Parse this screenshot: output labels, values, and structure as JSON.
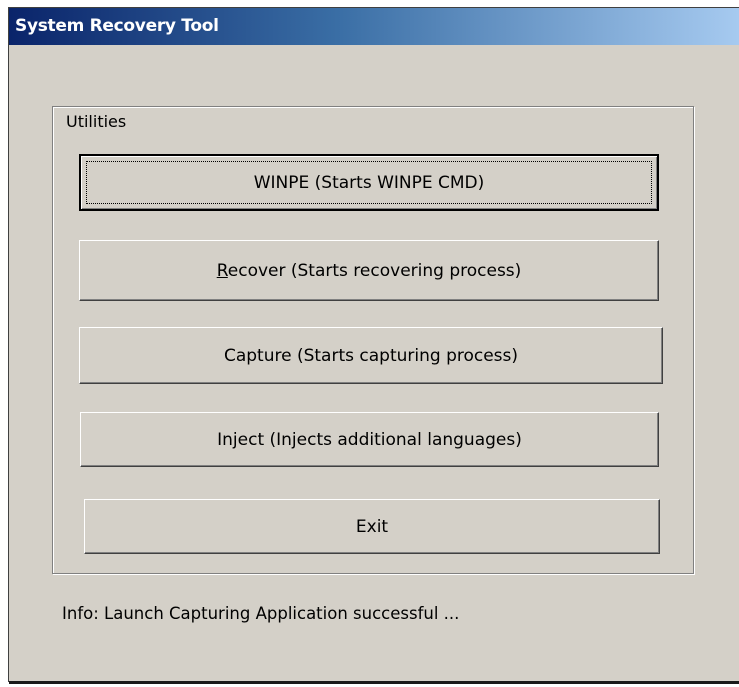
{
  "window": {
    "title": "System Recovery Tool"
  },
  "utilities": {
    "legend": "Utilities",
    "buttons": {
      "winpe": "WINPE (Starts WINPE CMD)",
      "recover_mnemonic": "R",
      "recover_rest": "ecover (Starts recovering process)",
      "capture": "Capture (Starts capturing process)",
      "inject": "Inject (Injects additional languages)",
      "exit": "Exit"
    }
  },
  "status": {
    "info": "Info: Launch Capturing Application successful ..."
  }
}
